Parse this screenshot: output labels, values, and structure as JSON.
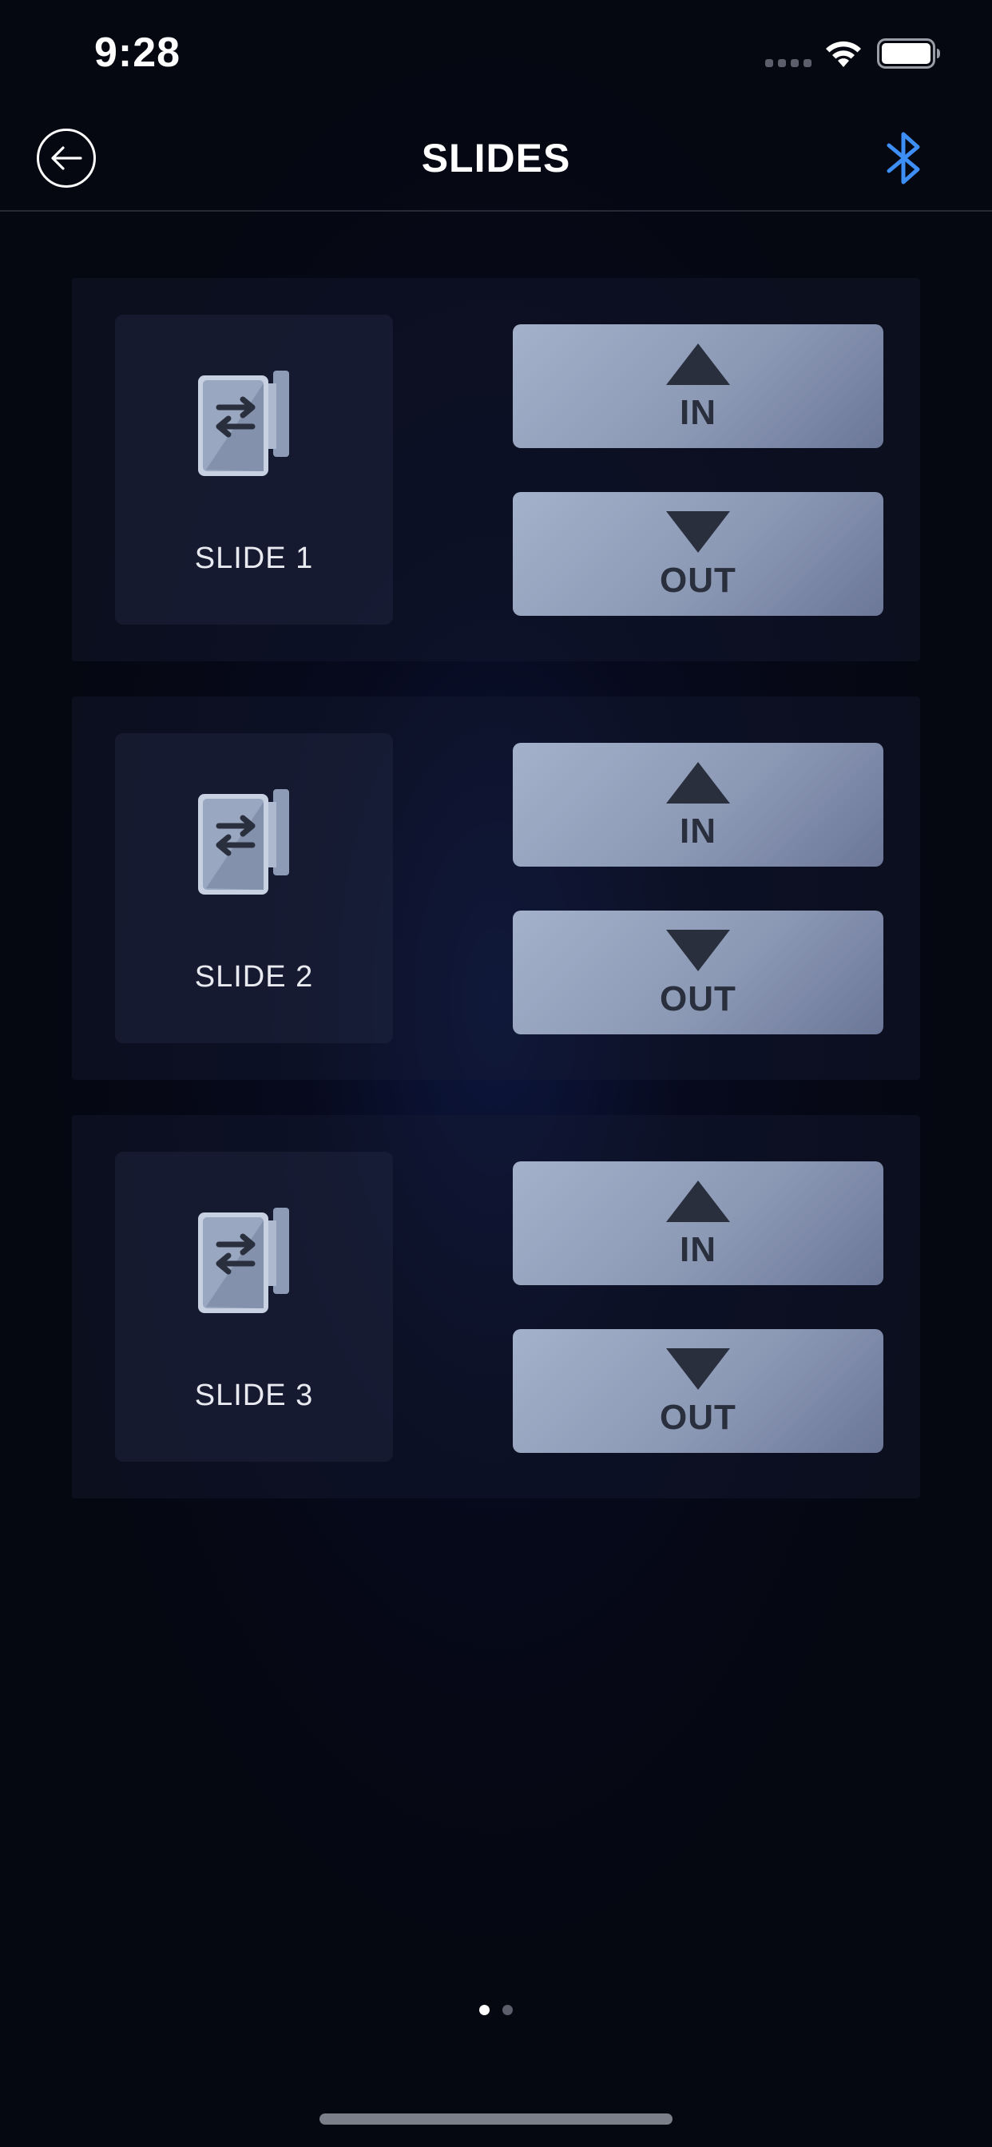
{
  "status_bar": {
    "time": "9:28"
  },
  "nav": {
    "title": "SLIDES",
    "back_icon": "back-arrow-circle-icon",
    "bluetooth_icon": "bluetooth-icon",
    "bluetooth_color": "#3d8ef5"
  },
  "slides": [
    {
      "label": "SLIDE 1",
      "in_label": "IN",
      "out_label": "OUT"
    },
    {
      "label": "SLIDE 2",
      "in_label": "IN",
      "out_label": "OUT"
    },
    {
      "label": "SLIDE 3",
      "in_label": "IN",
      "out_label": "OUT"
    }
  ],
  "pagination": {
    "total": 2,
    "current": 1,
    "active_color": "#ffffff",
    "inactive_color": "#5c5f6b"
  },
  "colors": {
    "background": "#050711",
    "button_fill": "#98a5c0",
    "button_text": "#2a2f3e"
  }
}
